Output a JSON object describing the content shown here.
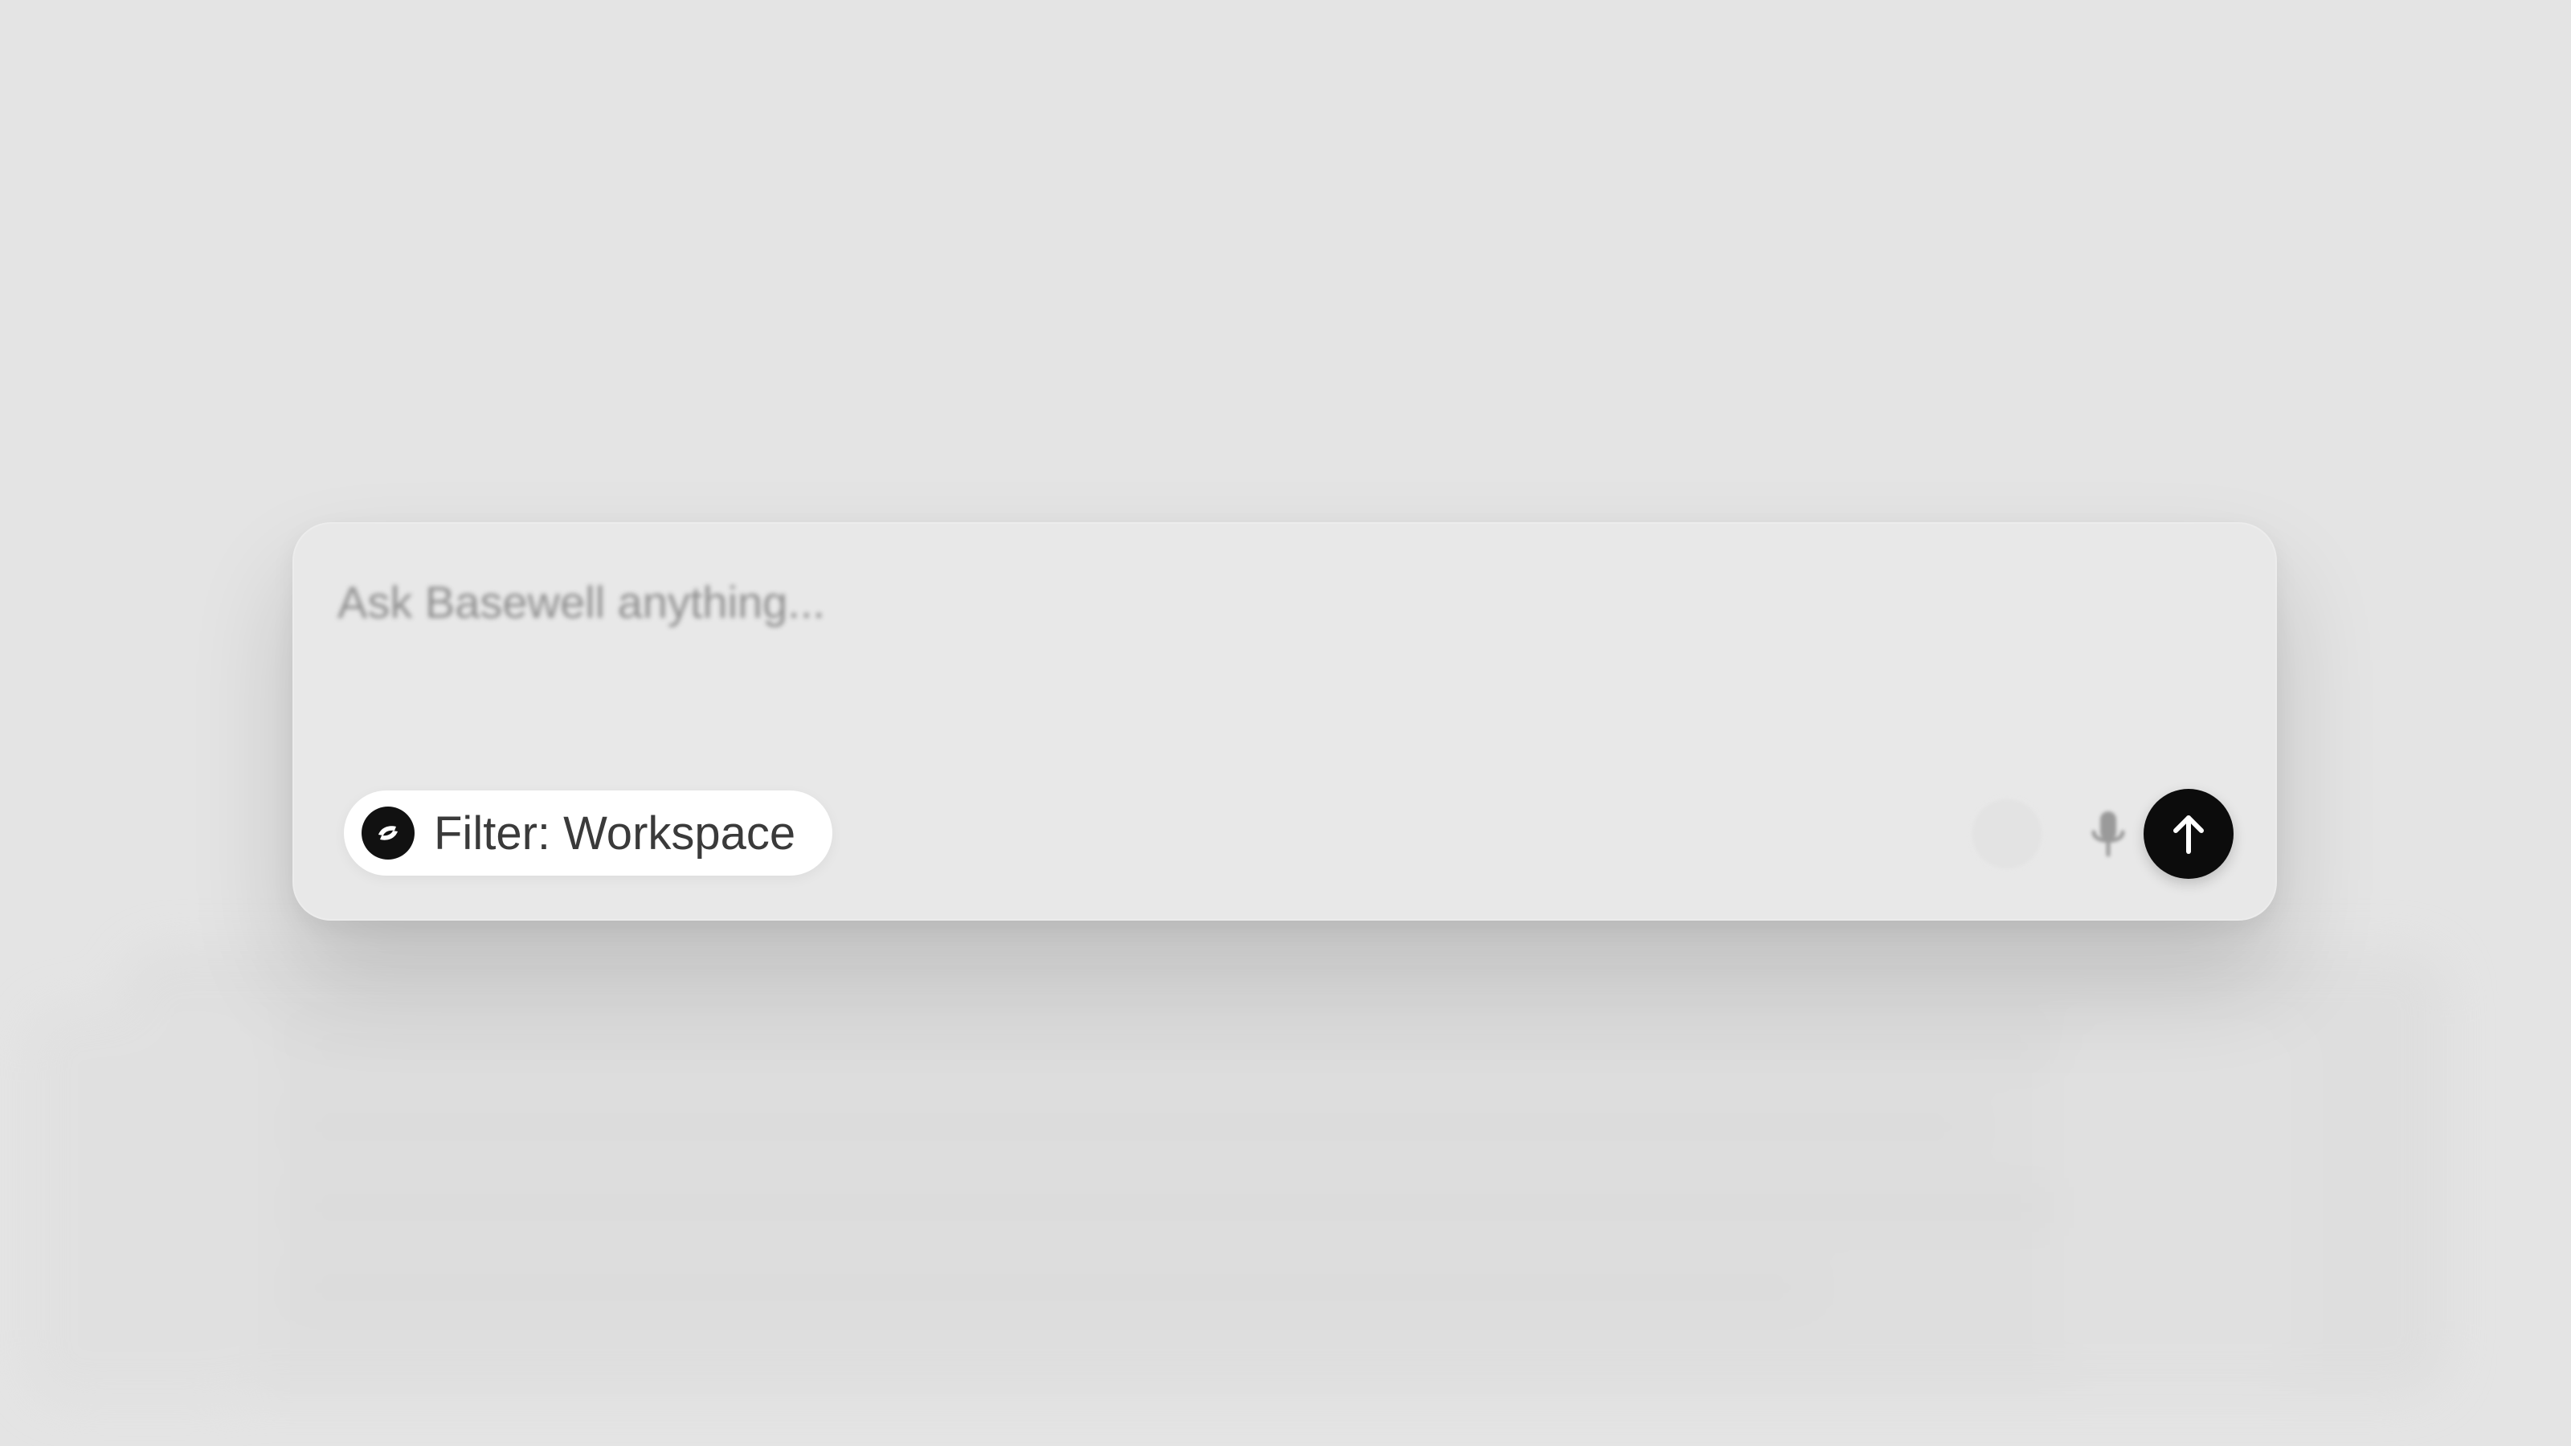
{
  "composer": {
    "placeholder": "Ask Basewell anything...",
    "filter_chip": {
      "label": "Filter: Workspace",
      "icon": "basewell-logo-icon"
    },
    "actions": {
      "attach_icon": "circle-icon",
      "mic_icon": "microphone-icon",
      "send_icon": "arrow-up-icon"
    }
  },
  "colors": {
    "background": "#e4e4e4",
    "card": "#e8e8e8",
    "chip": "#ffffff",
    "send_button": "#0c0c0c",
    "placeholder_text": "#8f8f8f"
  }
}
